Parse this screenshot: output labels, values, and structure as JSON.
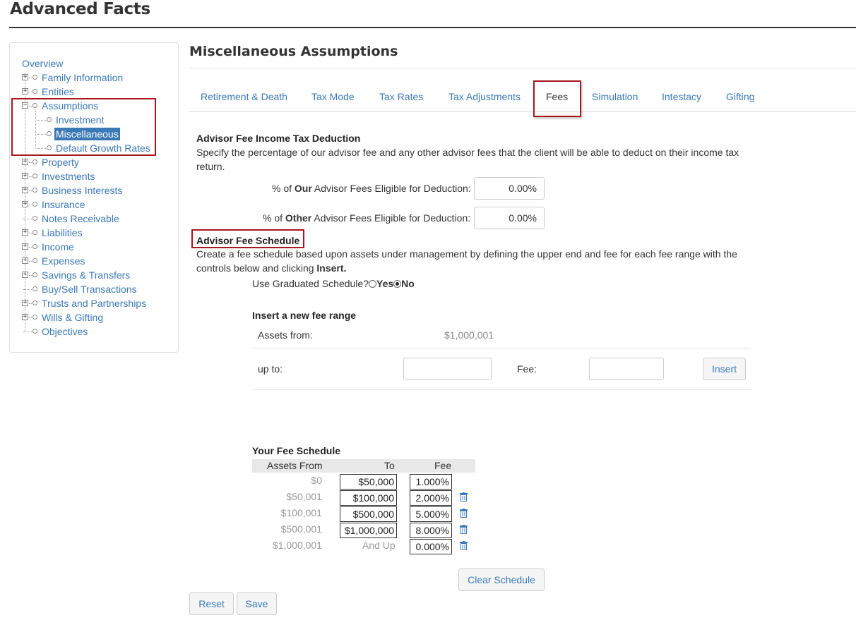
{
  "app": {
    "title": "Advanced Facts"
  },
  "colors": {
    "link": "#3b79b6",
    "highlight_box": "#a8171d",
    "selected_bg": "#3b79b6"
  },
  "sidebar": {
    "overview": "Overview",
    "items": [
      {
        "label": "Family Information",
        "expandable": true
      },
      {
        "label": "Entities",
        "expandable": true
      },
      {
        "label": "Assumptions",
        "expandable": true,
        "expanded": true,
        "children": [
          {
            "label": "Investment"
          },
          {
            "label": "Miscellaneous",
            "selected": true
          },
          {
            "label": "Default Growth Rates"
          }
        ]
      },
      {
        "label": "Property",
        "expandable": true
      },
      {
        "label": "Investments",
        "expandable": true
      },
      {
        "label": "Business Interests",
        "expandable": true
      },
      {
        "label": "Insurance",
        "expandable": true
      },
      {
        "label": "Notes Receivable",
        "expandable": false
      },
      {
        "label": "Liabilities",
        "expandable": true
      },
      {
        "label": "Income",
        "expandable": true
      },
      {
        "label": "Expenses",
        "expandable": true
      },
      {
        "label": "Savings & Transfers",
        "expandable": true
      },
      {
        "label": "Buy/Sell Transactions",
        "expandable": false
      },
      {
        "label": "Trusts and Partnerships",
        "expandable": true
      },
      {
        "label": "Wills & Gifting",
        "expandable": true
      },
      {
        "label": "Objectives",
        "expandable": false
      }
    ]
  },
  "main": {
    "title": "Miscellaneous Assumptions",
    "tabs": [
      {
        "label": "Retirement & Death"
      },
      {
        "label": "Tax Mode"
      },
      {
        "label": "Tax Rates"
      },
      {
        "label": "Tax Adjustments"
      },
      {
        "label": "Fees",
        "active": true
      },
      {
        "label": "Simulation"
      },
      {
        "label": "Intestacy"
      },
      {
        "label": "Gifting"
      }
    ],
    "deduction": {
      "title": "Advisor Fee Income Tax Deduction",
      "desc_line1": "Specify the percentage of our advisor fee and any other advisor fees that the client will be able to deduct on their income tax",
      "desc_line2": "return.",
      "our_pre": "% of ",
      "our_bold": "Our",
      "our_post": " Advisor Fees Eligible for Deduction:",
      "our_value": "0.00%",
      "other_pre": "% of ",
      "other_bold": "Other",
      "other_post": " Advisor Fees Eligible for Deduction:",
      "other_value": "0.00%"
    },
    "schedule": {
      "title": "Advisor Fee Schedule",
      "desc_line1": "Create a fee schedule based upon assets under management by defining the upper end and fee for each fee range with the",
      "desc_line2_pre": "controls below and clicking ",
      "desc_line2_bold": "Insert.",
      "graduated_label": "Use Graduated Schedule?",
      "yes": "Yes",
      "no": "No",
      "selected": "No",
      "insert_title": "Insert a new fee range",
      "assets_from_label": "Assets from:",
      "assets_from_value": "$1,000,001",
      "up_to_label": "up to:",
      "up_to_value": "",
      "fee_label": "Fee:",
      "fee_value": "",
      "insert_button": "Insert",
      "your_title": "Your Fee Schedule",
      "headers": {
        "from": "Assets From",
        "to": "To",
        "fee": "Fee"
      },
      "rows": [
        {
          "from": "$0",
          "to": "$50,000",
          "fee": "1.000%",
          "deletable": false
        },
        {
          "from": "$50,001",
          "to": "$100,000",
          "fee": "2.000%",
          "deletable": true
        },
        {
          "from": "$100,001",
          "to": "$500,000",
          "fee": "5.000%",
          "deletable": true
        },
        {
          "from": "$500,001",
          "to": "$1,000,000",
          "fee": "8.000%",
          "deletable": true
        },
        {
          "from": "$1,000,001",
          "to": "And Up",
          "fee": "0.000%",
          "deletable": true
        }
      ],
      "clear_button": "Clear Schedule"
    },
    "reset_button": "Reset",
    "save_button": "Save"
  }
}
